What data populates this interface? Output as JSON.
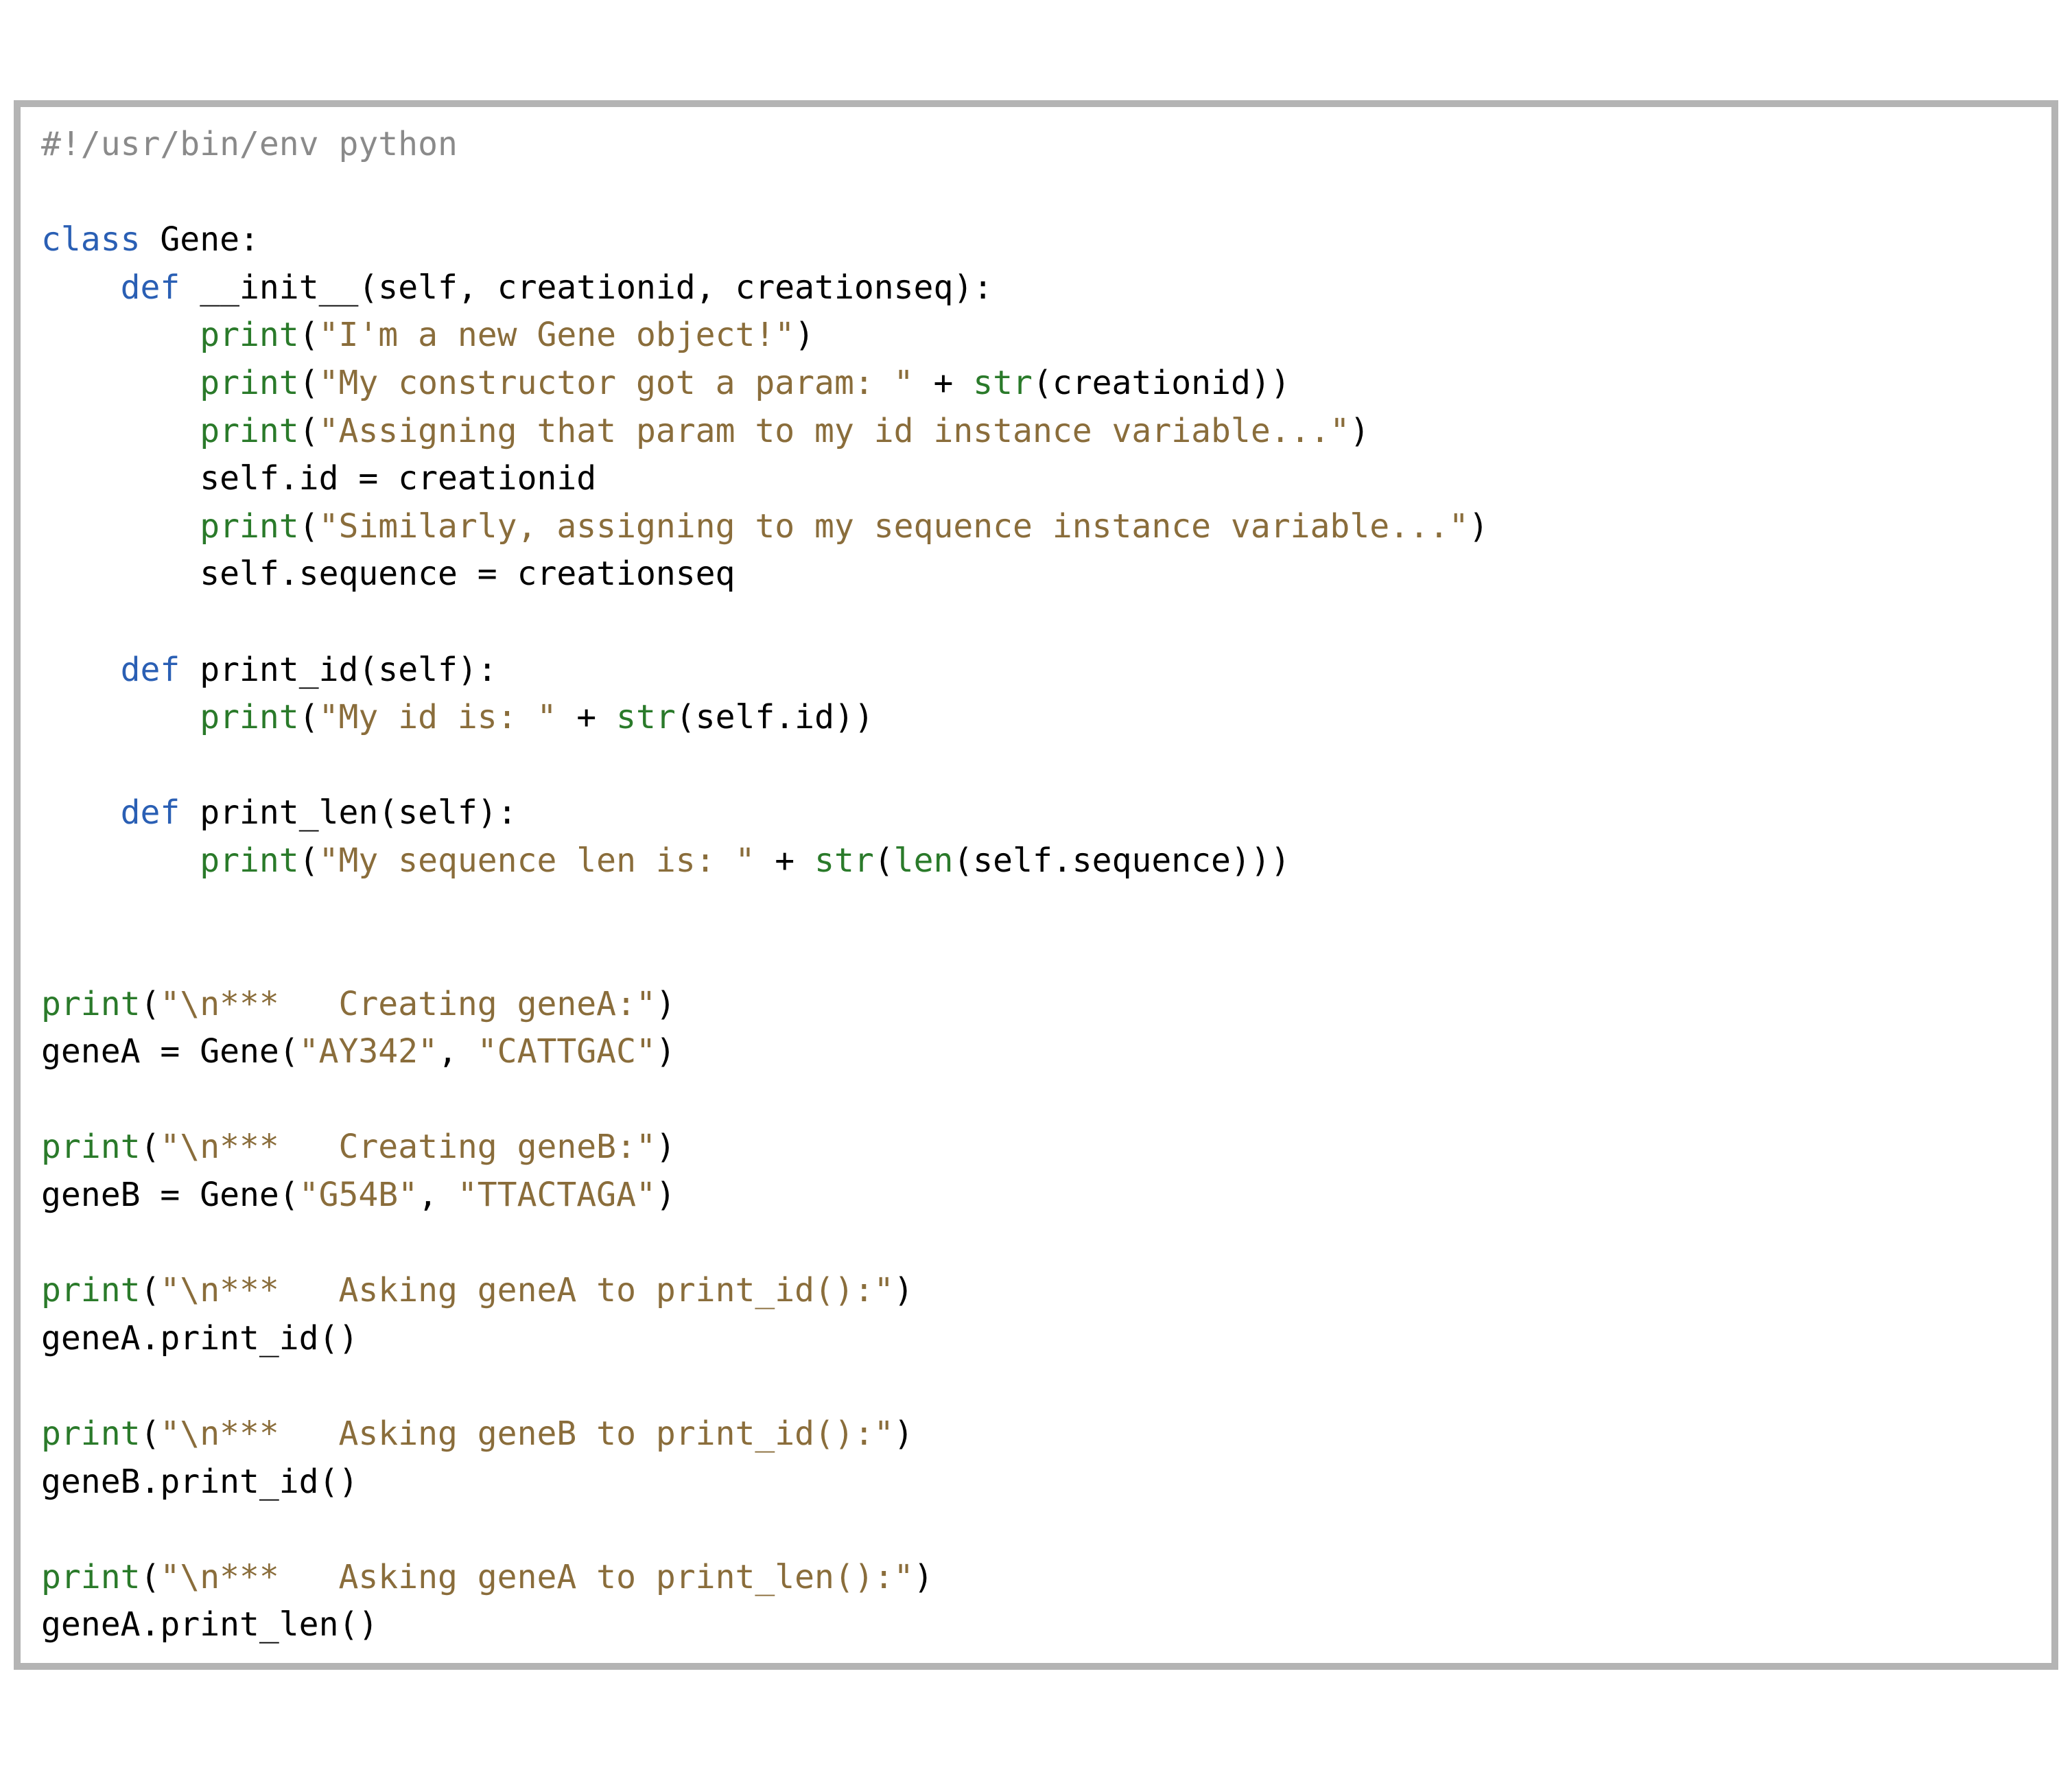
{
  "code": {
    "shebang": "#!/usr/bin/env python",
    "class_kw": "class",
    "class_name": "Gene",
    "colon": ":",
    "def_kw": "def",
    "init_name": "__init__",
    "init_params": "(self, creationid, creationseq):",
    "print_builtin": "print",
    "str_builtin": "str",
    "len_builtin": "len",
    "s_new_gene": "\"I'm a new Gene object!\"",
    "s_got_param": "\"My constructor got a param: \"",
    "plus": " + ",
    "v_creationid": "(creationid))",
    "s_assign_id": "\"Assigning that param to my id instance variable...\"",
    "assign_id": "self.id = creationid",
    "s_assign_seq": "\"Similarly, assigning to my sequence instance variable...\"",
    "assign_seq": "self.sequence = creationseq",
    "printid_name": "print_id",
    "printid_params": "(self):",
    "s_my_id": "\"My id is: \"",
    "v_self_id": "(self.id))",
    "printlen_name": "print_len",
    "printlen_params": "(self):",
    "s_my_seqlen": "\"My sequence len is: \"",
    "v_len_seq": "(self.sequence)))",
    "s_creating_a": "\"\\n***   Creating geneA:\"",
    "ga_assign_pre": "geneA = Gene(",
    "ga_arg1": "\"AY342\"",
    "comma_sp": ", ",
    "ga_arg2": "\"CATTGAC\"",
    "close_paren": ")",
    "s_creating_b": "\"\\n***   Creating geneB:\"",
    "gb_assign_pre": "geneB = Gene(",
    "gb_arg1": "\"G54B\"",
    "gb_arg2": "\"TTACTAGA\"",
    "s_ask_a_id": "\"\\n***   Asking geneA to print_id():\"",
    "ga_printid": "geneA.print_id()",
    "s_ask_b_id": "\"\\n***   Asking geneB to print_id():\"",
    "gb_printid": "geneB.print_id()",
    "s_ask_a_len": "\"\\n***   Asking geneA to print_len():\"",
    "ga_printlen": "geneA.print_len()"
  }
}
